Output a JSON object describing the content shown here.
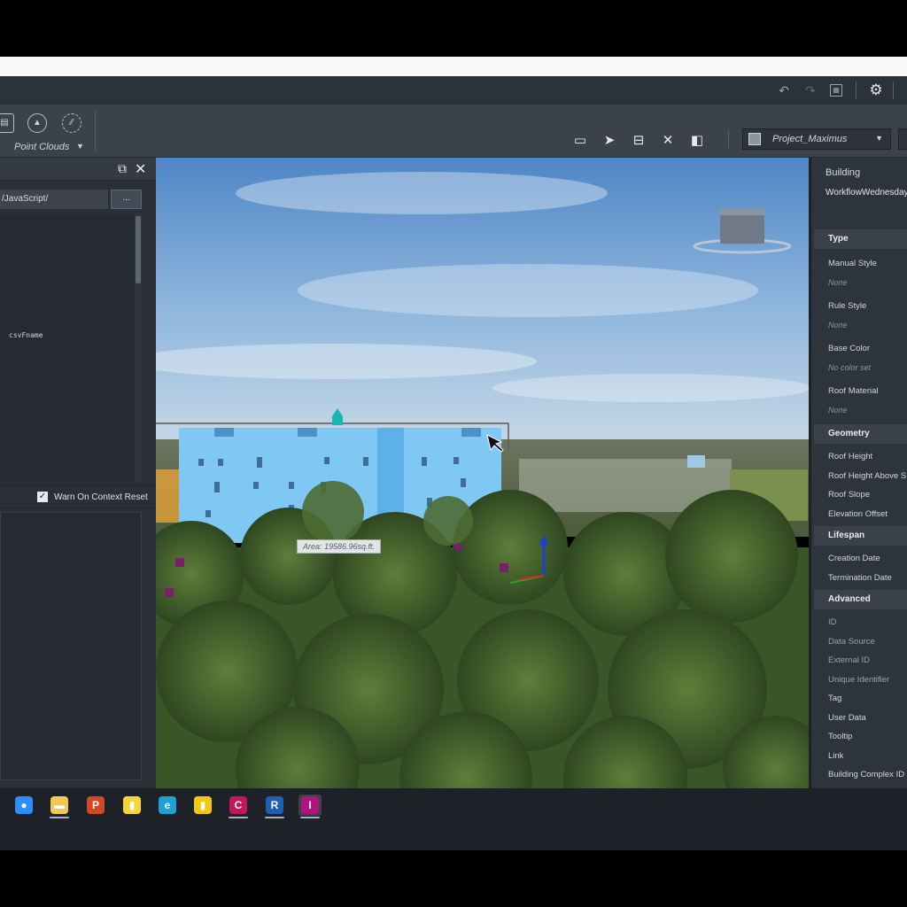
{
  "ribbon": {
    "point_clouds_label": "Point Clouds",
    "caret": "▼",
    "project_name": "Project_Maximus",
    "project_caret": "▼"
  },
  "script_panel": {
    "path_value": "/JavaScript/",
    "browse_label": "...",
    "code_token": "csvFname",
    "warn_label": "Warn On Context Reset",
    "warn_checked": true,
    "warn_check_glyph": "✓"
  },
  "viewport": {
    "area_label": "Area: 19586.96sq.ft."
  },
  "properties": {
    "header": "Building",
    "item_name": "WorkflowWednesday",
    "sections": {
      "type": "Type",
      "geometry": "Geometry",
      "lifespan": "Lifespan",
      "advanced": "Advanced"
    },
    "type_fields": [
      {
        "label": "Manual Style",
        "value": "None"
      },
      {
        "label": "Rule Style",
        "value": "None"
      },
      {
        "label": "Base Color",
        "value": "No color set"
      },
      {
        "label": "Roof Material",
        "value": "None"
      }
    ],
    "geometry_fields": [
      "Roof Height",
      "Roof Height Above S",
      "Roof Slope",
      "Elevation Offset"
    ],
    "lifespan_fields": [
      "Creation Date",
      "Termination Date"
    ],
    "advanced_fields": [
      "ID",
      "Data Source",
      "External ID",
      "Unique Identifier",
      "Tag",
      "User Data",
      "Tooltip",
      "Link",
      "Building Complex ID"
    ]
  },
  "taskbar": {
    "apps": [
      {
        "icon": "zoom-app-icon",
        "glyph": "●",
        "color": "#2d8cff"
      },
      {
        "icon": "file-explorer-icon",
        "glyph": "▬",
        "color": "#f2c94c"
      },
      {
        "icon": "powerpoint-icon",
        "glyph": "P",
        "color": "#d24726"
      },
      {
        "icon": "sticky-notes-icon",
        "glyph": "▮",
        "color": "#f7d33c"
      },
      {
        "icon": "edge-browser-icon",
        "glyph": "e",
        "color": "#1fa1d8"
      },
      {
        "icon": "power-bi-icon",
        "glyph": "▮",
        "color": "#f2c811"
      },
      {
        "icon": "autodesk-c-app-icon",
        "glyph": "C",
        "color": "#c2185b"
      },
      {
        "icon": "revit-icon",
        "glyph": "R",
        "color": "#1e5fb4"
      },
      {
        "icon": "infraworks-icon",
        "glyph": "I",
        "color": "#b0147e"
      }
    ]
  },
  "colors": {
    "accent_taskbar_underline": "#9fb4c8",
    "building_facade": "#7fc8f4",
    "foliage": "#3f5f2a",
    "sky_top": "#4f86c6"
  }
}
